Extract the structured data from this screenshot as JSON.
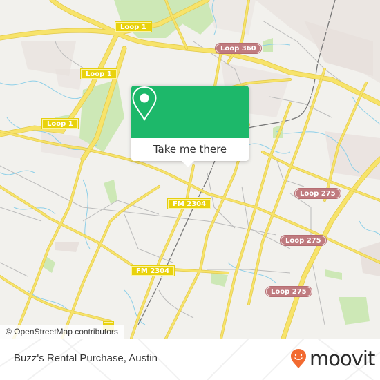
{
  "map": {
    "attribution": "© OpenStreetMap contributors",
    "colors": {
      "background": "#f2f1ed",
      "major_road": "#f7e36a",
      "park": "#cde8b6",
      "urban": "#e8e1dd",
      "water": "#8dcfe8",
      "rail": "#777777",
      "minor_road": "#bbbbbb"
    },
    "road_labels": [
      {
        "id": "loop1-top",
        "text": "Loop 1",
        "style": "loop1"
      },
      {
        "id": "loop1-mid",
        "text": "Loop 1",
        "style": "loop1"
      },
      {
        "id": "loop1-left",
        "text": "Loop 1",
        "style": "loop1"
      },
      {
        "id": "loop360",
        "text": "Loop 360",
        "style": "loopr"
      },
      {
        "id": "fm2304-a",
        "text": "FM 2304",
        "style": "fm"
      },
      {
        "id": "fm2304-b",
        "text": "FM 2304",
        "style": "fm"
      },
      {
        "id": "loop275-a",
        "text": "Loop 275",
        "style": "loopr"
      },
      {
        "id": "loop275-b",
        "text": "Loop 275",
        "style": "loopr"
      },
      {
        "id": "loop275-c",
        "text": "Loop 275",
        "style": "loopr"
      }
    ]
  },
  "popup": {
    "icon": "map-pin-icon",
    "button_label": "Take me there",
    "accent": "#1db86a"
  },
  "footer": {
    "place_title": "Buzz's Rental Purchase, Austin",
    "logo_text": "moovit",
    "logo_color": "#f26a30"
  }
}
